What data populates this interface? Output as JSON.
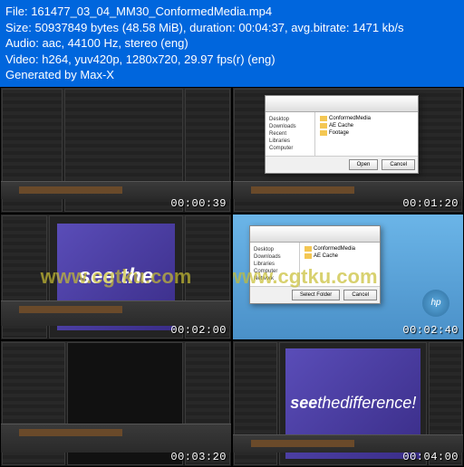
{
  "header": {
    "file_label": "File:",
    "file_value": "161477_03_04_MM30_ConformedMedia.mp4",
    "size_label": "Size:",
    "size_bytes": "50937849 bytes",
    "size_mib": "(48.58 MiB)",
    "duration_label": "duration:",
    "duration_value": "00:04:37,",
    "bitrate_label": "avg.bitrate:",
    "bitrate_value": "1471 kb/s",
    "audio_label": "Audio:",
    "audio_value": "aac, 44100 Hz, stereo (eng)",
    "video_label": "Video:",
    "video_value": "h264, yuv420p, 1280x720, 29.97 fps(r) (eng)",
    "generated_by": "Generated by Max-X"
  },
  "watermark": "www.cgtku.com",
  "timestamps": {
    "t1": "00:00:39",
    "t2": "00:01:20",
    "t3": "00:02:00",
    "t4": "00:02:40",
    "t5": "00:03:20",
    "t6": "00:04:00"
  },
  "video_text": {
    "see_partial": "see the",
    "see_full_bold": "see",
    "see_full_thin": "thedifference!"
  },
  "dialog": {
    "sidebar": [
      "Desktop",
      "Downloads",
      "Recent",
      "Libraries",
      "Computer",
      "Network"
    ],
    "files": [
      "ConformedMedia",
      "AE Cache",
      "Footage"
    ],
    "open_btn": "Open",
    "cancel_btn": "Cancel",
    "select_btn": "Select Folder"
  },
  "hp_label": "hp"
}
